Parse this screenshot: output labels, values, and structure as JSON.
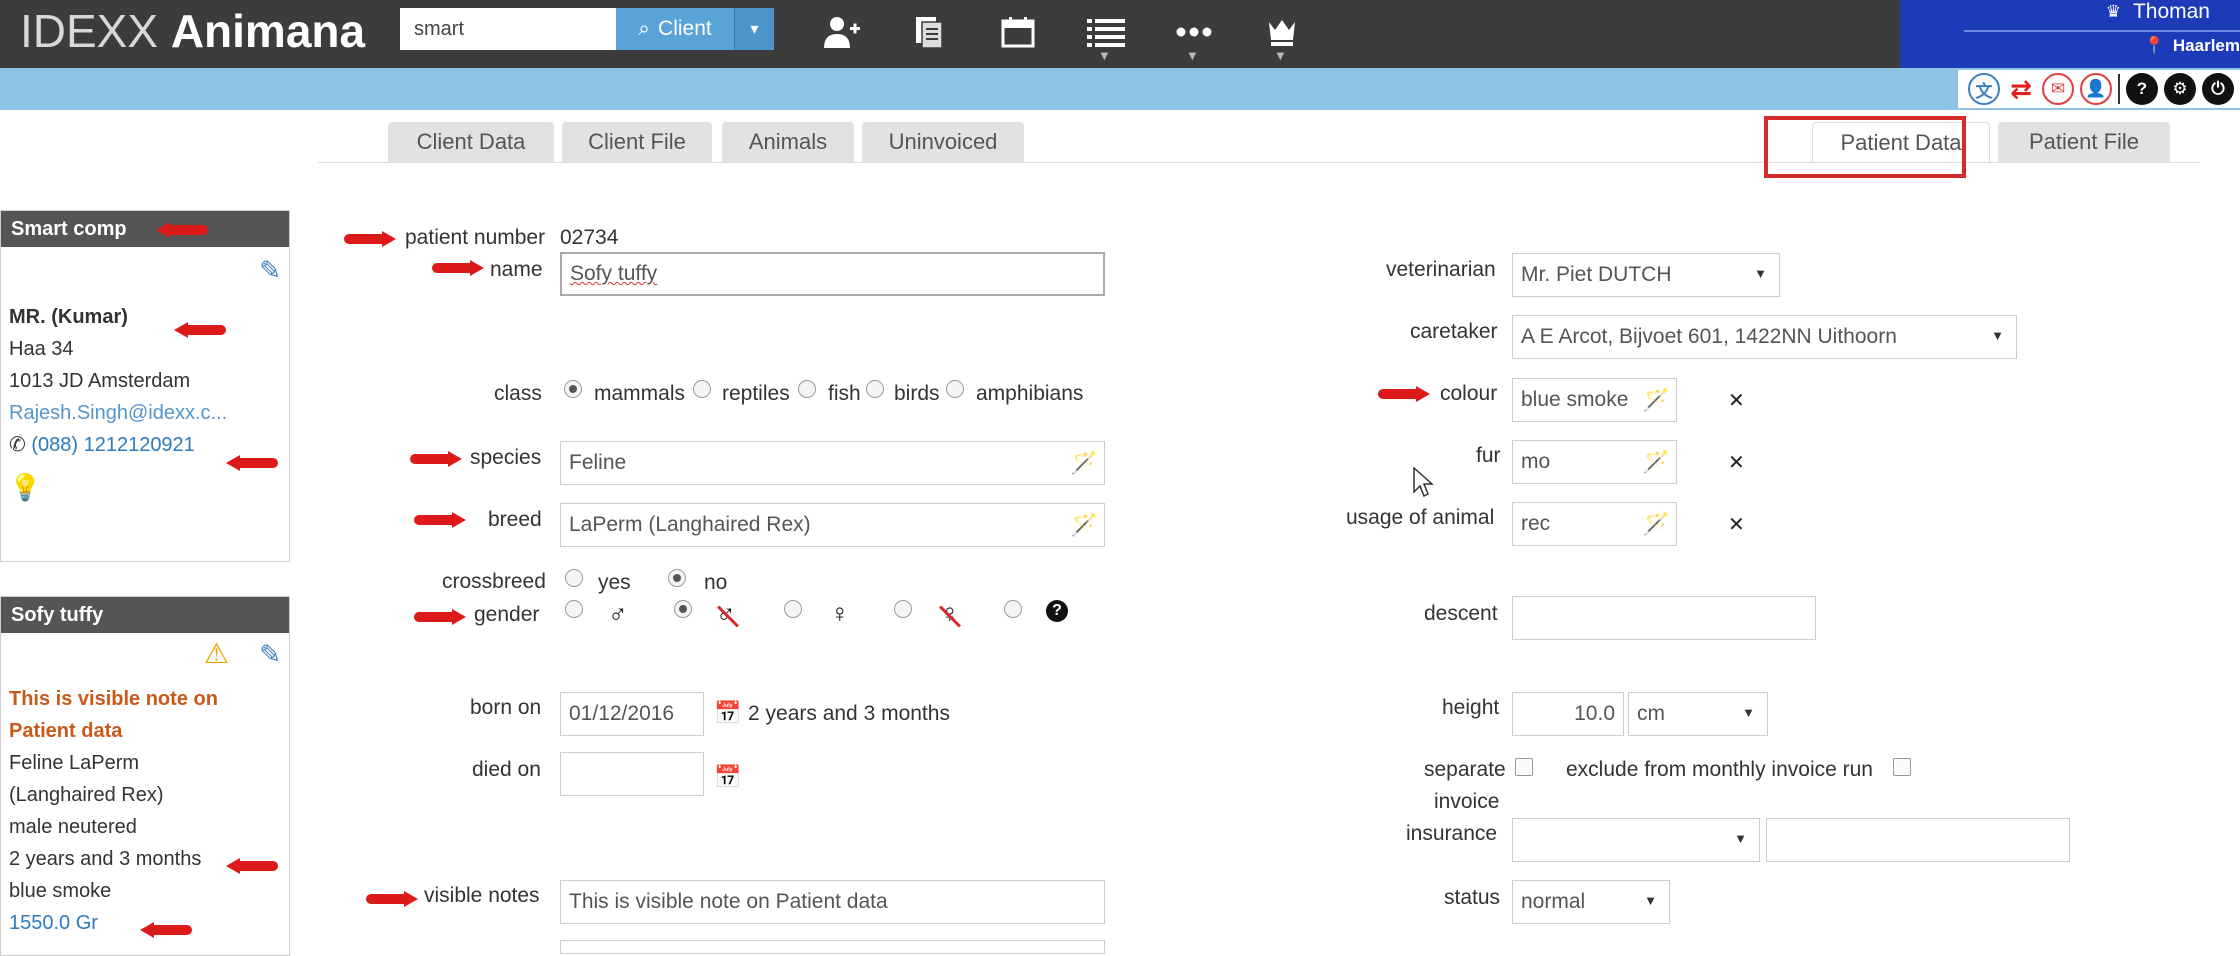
{
  "header": {
    "logo_light": "IDEXX",
    "logo_bold": "Animana",
    "search_value": "smart",
    "search_button": "Client",
    "user_name": "Thoman",
    "location": "Haarlem"
  },
  "tabs": {
    "client_data": "Client Data",
    "client_file": "Client File",
    "animals": "Animals",
    "uninvoiced": "Uninvoiced",
    "patient_data": "Patient Data",
    "patient_file": "Patient File"
  },
  "client_card": {
    "title": "Smart comp",
    "name": "MR. (Kumar)",
    "address1": "Haa          34",
    "address2": "1013 JD Amsterdam",
    "email": "Rajesh.Singh@idexx.c...",
    "phone": "(088) 1212120921"
  },
  "patient_card": {
    "title": "Sofy tuffy",
    "note_line1": "This is visible note on",
    "note_line2": "Patient data",
    "species_breed1": "Feline   LaPerm",
    "species_breed2": "(Langhaired Rex)",
    "gender": "male neutered",
    "age": "2 years and 3 months",
    "colour": "blue smoke",
    "weight": "1550.0 Gr"
  },
  "form": {
    "patient_number_label": "patient number",
    "patient_number": "02734",
    "name_label": "name",
    "name": "Sofy tuffy",
    "class_label": "class",
    "class_options": [
      "mammals",
      "reptiles",
      "fish",
      "birds",
      "amphibians"
    ],
    "species_label": "species",
    "species": "Feline",
    "breed_label": "breed",
    "breed": "LaPerm (Langhaired Rex)",
    "crossbreed_label": "crossbreed",
    "yes": "yes",
    "no": "no",
    "gender_label": "gender",
    "born_label": "born on",
    "born_on": "01/12/2016",
    "age_text": "2 years and 3 months",
    "died_label": "died on",
    "visible_notes_label": "visible notes",
    "visible_notes": "This is visible note on Patient data",
    "veterinarian_label": "veterinarian",
    "veterinarian": "Mr. Piet DUTCH",
    "caretaker_label": "caretaker",
    "caretaker": "A E Arcot, Bijvoet 601, 1422NN Uithoorn",
    "colour_label": "colour",
    "colour": "blue smoke",
    "fur_label": "fur",
    "fur": "mo",
    "usage_label": "usage of animal",
    "usage": "rec",
    "descent_label": "descent",
    "height_label": "height",
    "height": "10.0",
    "height_unit": "cm",
    "separate_label_1": "separate",
    "separate_label_2": "invoice",
    "exclude_label": "exclude from monthly invoice run",
    "insurance_label": "insurance",
    "status_label": "status",
    "status": "normal"
  },
  "colors": {
    "topbar": "#3c3c3c",
    "accent_blue": "#5aa3d6",
    "user_area": "#1d3bb8",
    "strip": "#8fc3e4",
    "highlight_red": "#d62b2b"
  }
}
